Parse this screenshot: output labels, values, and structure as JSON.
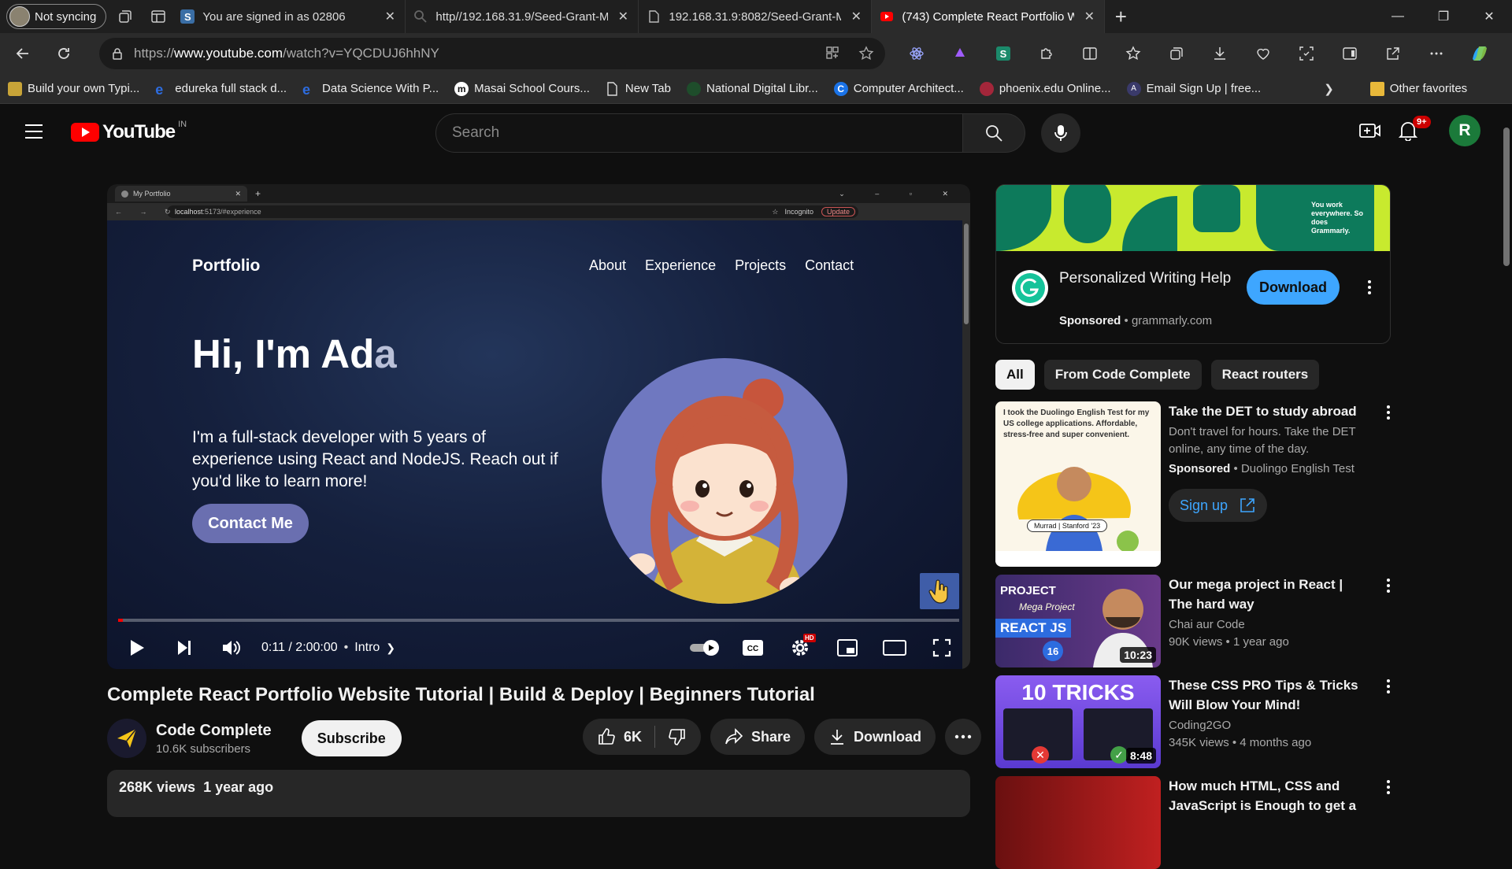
{
  "browser": {
    "profile_label": "Not syncing",
    "tabs": [
      {
        "title": "You are signed in as 02806",
        "active": false
      },
      {
        "title": "http//192.168.31.9/Seed-Grant-M",
        "active": false
      },
      {
        "title": "192.168.31.9:8082/Seed-Grant-M",
        "active": false
      },
      {
        "title": "(743) Complete React Portfolio W",
        "active": true
      }
    ],
    "url_prefix": "https://",
    "url_host": "www.youtube.com",
    "url_path": "/watch?v=YQCDUJ6hhNY",
    "bookmarks": [
      "Build your own Typi...",
      "edureka full stack d...",
      "Data Science With P...",
      "Masai School Cours...",
      "New Tab",
      "National Digital Libr...",
      "Computer Architect...",
      "phoenix.edu Online...",
      "Email Sign Up | free..."
    ],
    "other_favorites": "Other favorites"
  },
  "youtube": {
    "logo_text": "YouTube",
    "region": "IN",
    "search_placeholder": "Search",
    "notifications_badge": "9+",
    "user_initial": "R"
  },
  "video_frame": {
    "tab_title": "My Portfolio",
    "url_host": "localhost",
    "url_rest": ":5173/#experience",
    "incognito": "Incognito",
    "update": "Update",
    "brand": "Portfolio",
    "nav": [
      "About",
      "Experience",
      "Projects",
      "Contact"
    ],
    "hi_main": "Hi, I'm Ad",
    "hi_fade": "a",
    "description": "I'm a full-stack developer with 5 years of experience using React and NodeJS. Reach out if you'd like to learn more!",
    "cta": "Contact Me"
  },
  "player": {
    "time": "0:11 / 2:00:00",
    "chapter": "Intro",
    "progress": 0.0015,
    "hd_badge": "HD"
  },
  "video": {
    "title": "Complete React Portfolio Website Tutorial | Build & Deploy | Beginners Tutorial",
    "channel": "Code Complete",
    "subscribers": "10.6K subscribers",
    "subscribe_label": "Subscribe",
    "likes": "6K",
    "share_label": "Share",
    "download_label": "Download",
    "views": "268K views",
    "age": "1 year ago"
  },
  "ad": {
    "banner_text": "You work everywhere. So does Grammarly.",
    "title": "Personalized Writing Help",
    "sponsored": "Sponsored",
    "domain": "grammarly.com",
    "cta": "Download"
  },
  "chips": [
    "All",
    "From Code Complete",
    "React routers"
  ],
  "recommendations": [
    {
      "title": "Take the DET to study abroad",
      "line1": "Don't travel for hours. Take the DET online, any time of the day.",
      "sponsored": "Sponsored",
      "advertiser": "Duolingo English Test",
      "cta": "Sign up",
      "thumb_quote": "I took the Duolingo English Test for my US college applications. Affordable, stress-free and super convenient.",
      "thumb_caption": "Murrad | Stanford '23"
    },
    {
      "title": "Our mega project in React | The hard way",
      "channel": "Chai aur Code",
      "meta": "90K views • 1 year ago",
      "duration": "10:23",
      "thumb_text1": "PROJECT",
      "thumb_text2": "Mega Project",
      "thumb_text3": "REACT JS",
      "thumb_num": "16"
    },
    {
      "title": "These CSS PRO Tips & Tricks Will Blow Your Mind!",
      "channel": "Coding2GO",
      "meta": "345K views • 4 months ago",
      "duration": "8:48",
      "thumb_text1": "10 TRICKS"
    },
    {
      "title": "How much HTML, CSS and JavaScript is Enough to get a",
      "channel": "",
      "meta": ""
    }
  ]
}
